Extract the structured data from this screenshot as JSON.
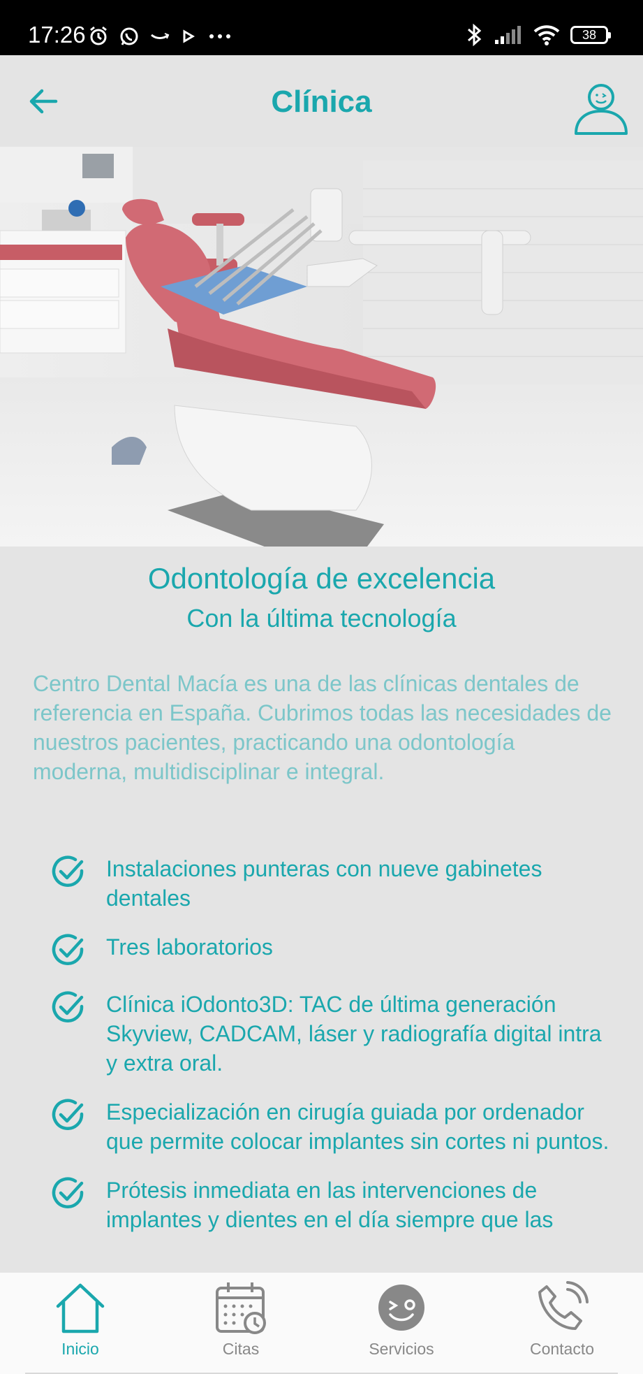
{
  "status_bar": {
    "time": "17:26",
    "battery": "38",
    "left_icons": [
      "alarm-icon",
      "whatsapp-icon",
      "amazon-icon",
      "play-icon",
      "more-dots-icon"
    ],
    "right_icons": [
      "bluetooth-icon",
      "signal-icon",
      "wifi-icon",
      "battery-icon"
    ]
  },
  "app_bar": {
    "title": "Clínica",
    "back_icon": "arrow-left-icon",
    "profile_icon": "user-icon"
  },
  "hero": {
    "description_icon": "dental-chair-photo"
  },
  "content": {
    "headline": "Odontología de excelencia",
    "subheadline": "Con la última tecnología",
    "intro": "Centro Dental Macía es una de las clínicas dentales de referencia en España. Cubrimos todas las necesidades de nuestros pacientes, practicando una odontología moderna, multidisciplinar e integral.",
    "features": [
      "Instalaciones punteras con nueve gabinetes dentales",
      "Tres laboratorios",
      "Clínica iOdonto3D: TAC de última generación Skyview, CADCAM, láser y radiografía digital intra y extra oral.",
      "Especialización en cirugía guiada por ordenador que permite colocar implantes sin cortes ni puntos.",
      "Prótesis inmediata en las intervenciones de implantes y dientes en el día siempre que las"
    ]
  },
  "bottom_nav": {
    "items": [
      {
        "label": "Inicio",
        "icon": "home-icon",
        "active": true
      },
      {
        "label": "Citas",
        "icon": "calendar-icon",
        "active": false
      },
      {
        "label": "Servicios",
        "icon": "smiley-icon",
        "active": false
      },
      {
        "label": "Contacto",
        "icon": "phone-icon",
        "active": false
      }
    ]
  },
  "colors": {
    "accent": "#1aa7ad",
    "intro_text": "#7cc6c9",
    "background": "#e4e4e4",
    "nav_inactive": "#888888"
  }
}
